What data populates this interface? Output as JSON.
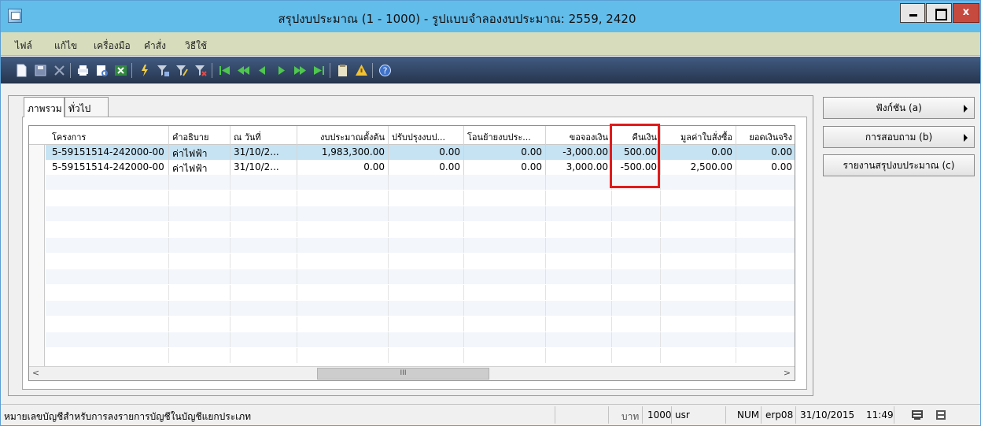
{
  "window": {
    "title": "สรุปงบประมาณ (1 - 1000) - รูปแบบจำลองงบประมาณ: 2559, 2420",
    "close_label": "x"
  },
  "menu": [
    "ไฟล์",
    "แก้ไข",
    "เครื่องมือ",
    "คำสั่ง",
    "วิธีใช้"
  ],
  "toolbar_icons": [
    "new-icon",
    "save-icon",
    "delete-icon",
    "print-icon",
    "print-preview-icon",
    "excel-icon",
    "filter-icon",
    "filter-by-selection-icon",
    "advanced-filter-icon",
    "clear-filter-icon",
    "first-record-icon",
    "previous-page-icon",
    "previous-record-icon",
    "next-record-icon",
    "next-page-icon",
    "last-record-icon",
    "attachment-icon",
    "alert-icon",
    "help-icon"
  ],
  "tabs": [
    "ภาพรวม",
    "ทั่วไป"
  ],
  "grid": {
    "columns": [
      "โครงการ",
      "คำอธิบาย",
      "ณ วันที่",
      "งบประมาณตั้งต้น",
      "ปรับปรุงงบป...",
      "โอนย้ายงบประ...",
      "ขอจองเงิน",
      "คืนเงิน",
      "มูลค่าใบสั่งซื้อ",
      "ยอดเงินจริง"
    ],
    "rows": [
      [
        "5-59151514-242000-00",
        "ค่าไฟฟ้า",
        "31/10/2...",
        "1,983,300.00",
        "0.00",
        "0.00",
        "-3,000.00",
        "500.00",
        "0.00",
        "0.00"
      ],
      [
        "5-59151514-242000-00",
        "ค่าไฟฟ้า",
        "31/10/2...",
        "0.00",
        "0.00",
        "0.00",
        "3,000.00",
        "-500.00",
        "2,500.00",
        "0.00"
      ]
    ],
    "scroll_left": "<",
    "scroll_right": ">",
    "scroll_thumb": "III"
  },
  "side_buttons": {
    "functions": "ฟังก์ชัน (a)",
    "inquiries": "การสอบถาม (b)",
    "report": "รายงานสรุปงบประมาณ (c)"
  },
  "status": {
    "message": "หมายเลขบัญชีสำหรับการลงรายการบัญชีในบัญชีแยกประเภท",
    "currency": "บาท",
    "company": "1000",
    "user": "usr",
    "numlock": "NUM",
    "server": "erp08",
    "date": "31/10/2015",
    "time": "11:49"
  },
  "colors": {
    "titlebar": "#63bdeb",
    "menubar": "#d7ddbc",
    "toolbar": "#31446a",
    "selected_row": "#c6e3f4",
    "highlight": "#e01b1b"
  }
}
